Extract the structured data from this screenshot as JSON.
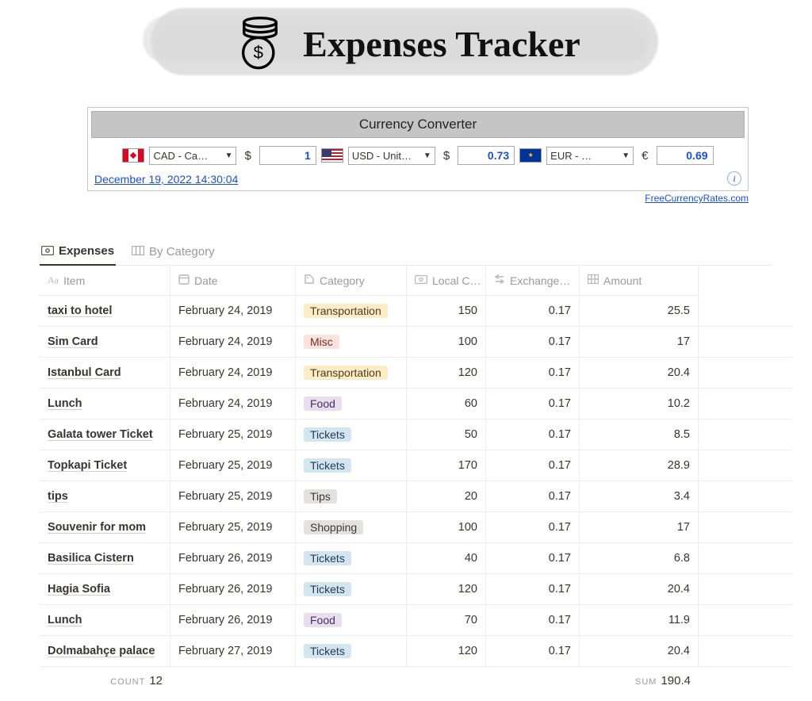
{
  "header": {
    "title": "Expenses Tracker"
  },
  "converter": {
    "title": "Currency Converter",
    "entries": [
      {
        "flag": "ca",
        "currency_label": "CAD - Ca…",
        "symbol": "$",
        "value": "1"
      },
      {
        "flag": "us",
        "currency_label": "USD - Unit…",
        "symbol": "$",
        "value": "0.73"
      },
      {
        "flag": "eu",
        "currency_label": "EUR - …",
        "symbol": "€",
        "value": "0.69"
      }
    ],
    "timestamp": "December 19, 2022 14:30:04",
    "attribution": "FreeCurrencyRates.com"
  },
  "tabs": [
    {
      "id": "expenses",
      "label": "Expenses",
      "icon": "money-icon",
      "active": true
    },
    {
      "id": "by-category",
      "label": "By Category",
      "icon": "board-icon",
      "active": false
    }
  ],
  "columns": [
    {
      "id": "item",
      "label": "Item",
      "icon": "Aa"
    },
    {
      "id": "date",
      "label": "Date",
      "icon": "📅"
    },
    {
      "id": "category",
      "label": "Category",
      "icon": "🏷"
    },
    {
      "id": "local",
      "label": "Local C…",
      "icon": "💶"
    },
    {
      "id": "rate",
      "label": "Exchange…",
      "icon": "🔀"
    },
    {
      "id": "amount",
      "label": "Amount",
      "icon": "🧮"
    }
  ],
  "rows": [
    {
      "item": "taxi to hotel",
      "date": "February 24, 2019",
      "category": "Transportation",
      "tag": "transportation",
      "local": "150",
      "rate": "0.17",
      "amount": "25.5"
    },
    {
      "item": "Sim Card",
      "date": "February 24, 2019",
      "category": "Misc",
      "tag": "misc",
      "local": "100",
      "rate": "0.17",
      "amount": "17"
    },
    {
      "item": "Istanbul Card",
      "date": "February 24, 2019",
      "category": "Transportation",
      "tag": "transportation",
      "local": "120",
      "rate": "0.17",
      "amount": "20.4"
    },
    {
      "item": "Lunch",
      "date": "February 24, 2019",
      "category": "Food",
      "tag": "food",
      "local": "60",
      "rate": "0.17",
      "amount": "10.2"
    },
    {
      "item": "Galata tower Ticket",
      "date": "February 25, 2019",
      "category": "Tickets",
      "tag": "tickets",
      "local": "50",
      "rate": "0.17",
      "amount": "8.5"
    },
    {
      "item": "Topkapi Ticket",
      "date": "February 25, 2019",
      "category": "Tickets",
      "tag": "tickets",
      "local": "170",
      "rate": "0.17",
      "amount": "28.9"
    },
    {
      "item": "tips",
      "date": "February 25, 2019",
      "category": "Tips",
      "tag": "tips",
      "local": "20",
      "rate": "0.17",
      "amount": "3.4"
    },
    {
      "item": "Souvenir for mom",
      "date": "February 25, 2019",
      "category": "Shopping",
      "tag": "shopping",
      "local": "100",
      "rate": "0.17",
      "amount": "17"
    },
    {
      "item": "Basilica Cistern",
      "date": "February 26, 2019",
      "category": "Tickets",
      "tag": "tickets",
      "local": "40",
      "rate": "0.17",
      "amount": "6.8"
    },
    {
      "item": "Hagia Sofia",
      "date": "February 26, 2019",
      "category": "Tickets",
      "tag": "tickets",
      "local": "120",
      "rate": "0.17",
      "amount": "20.4"
    },
    {
      "item": "Lunch",
      "date": "February 26, 2019",
      "category": "Food",
      "tag": "food",
      "local": "70",
      "rate": "0.17",
      "amount": "11.9"
    },
    {
      "item": "Dolmabahçe palace",
      "date": "February 27, 2019",
      "category": "Tickets",
      "tag": "tickets",
      "local": "120",
      "rate": "0.17",
      "amount": "20.4"
    }
  ],
  "aggregates": {
    "count_label": "COUNT",
    "count_value": "12",
    "sum_label": "SUM",
    "sum_value": "190.4"
  }
}
